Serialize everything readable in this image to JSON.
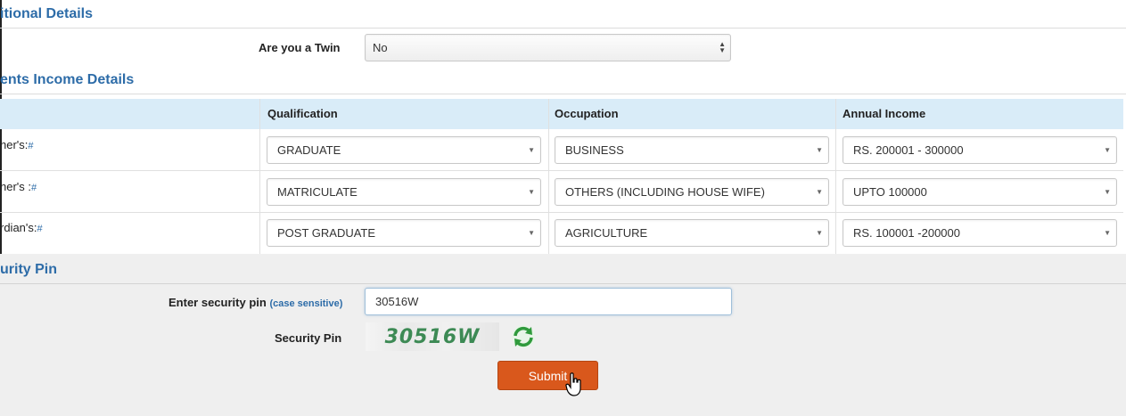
{
  "additional": {
    "section_title": "itional Details",
    "twin_label": "Are you a Twin",
    "twin_value": "No"
  },
  "income": {
    "section_title": "ents Income Details",
    "headers": [
      "Qualification",
      "Occupation",
      "Annual Income"
    ],
    "rows": [
      {
        "label": "her's:",
        "qualification": "GRADUATE",
        "occupation": "BUSINESS",
        "income": "RS. 200001 - 300000"
      },
      {
        "label": "her's :",
        "qualification": "MATRICULATE",
        "occupation": "OTHERS (INCLUDING HOUSE WIFE)",
        "income": "UPTO 100000"
      },
      {
        "label": "rdian's:",
        "qualification": "POST GRADUATE",
        "occupation": "AGRICULTURE",
        "income": "RS. 100001 -200000"
      }
    ],
    "required_mark": "#"
  },
  "security": {
    "section_title": "urity Pin",
    "enter_label": "Enter security pin",
    "case_note": "(case sensitive)",
    "pin_value": "30516W",
    "captcha_label": "Security Pin",
    "captcha_text": "30516W",
    "submit_label": "Submit"
  },
  "colors": {
    "accent": "#2d6ca8",
    "table_header": "#d9ecf8",
    "submit": "#d9581c",
    "captcha_text": "#3d8a55"
  }
}
